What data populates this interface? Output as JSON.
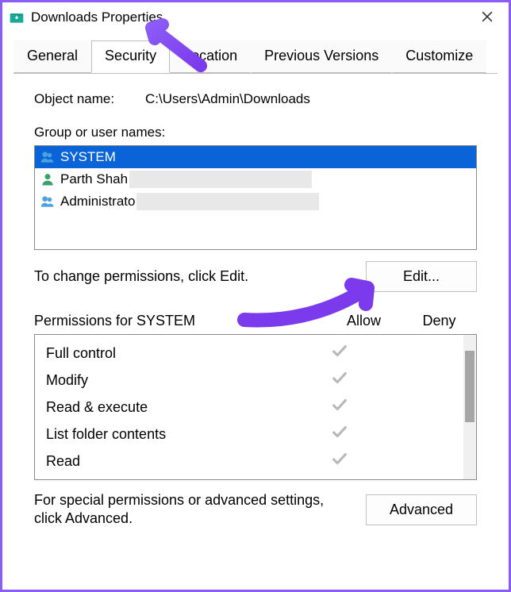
{
  "window": {
    "title": "Downloads Properties"
  },
  "tabs": {
    "items": [
      {
        "label": "General"
      },
      {
        "label": "Security"
      },
      {
        "label": "Location"
      },
      {
        "label": "Previous Versions"
      },
      {
        "label": "Customize"
      }
    ],
    "activeIndex": 1
  },
  "object": {
    "label": "Object name:",
    "value": "C:\\Users\\Admin\\Downloads"
  },
  "groupUsers": {
    "label": "Group or user names:",
    "items": [
      {
        "name": "SYSTEM",
        "iconType": "group",
        "selected": true
      },
      {
        "name": "Parth Shah",
        "iconType": "user",
        "truncated": true
      },
      {
        "name": "Administrators",
        "iconType": "group",
        "truncatedDisplay": "Administrato",
        "truncated": true
      }
    ]
  },
  "editHelp": "To change permissions, click Edit.",
  "editButton": "Edit...",
  "permissions": {
    "headerLabel": "Permissions for SYSTEM",
    "allowLabel": "Allow",
    "denyLabel": "Deny",
    "rows": [
      {
        "name": "Full control",
        "allow": true,
        "deny": false
      },
      {
        "name": "Modify",
        "allow": true,
        "deny": false
      },
      {
        "name": "Read & execute",
        "allow": true,
        "deny": false
      },
      {
        "name": "List folder contents",
        "allow": true,
        "deny": false
      },
      {
        "name": "Read",
        "allow": true,
        "deny": false
      }
    ]
  },
  "advanced": {
    "text": "For special permissions or advanced settings, click Advanced.",
    "button": "Advanced"
  }
}
